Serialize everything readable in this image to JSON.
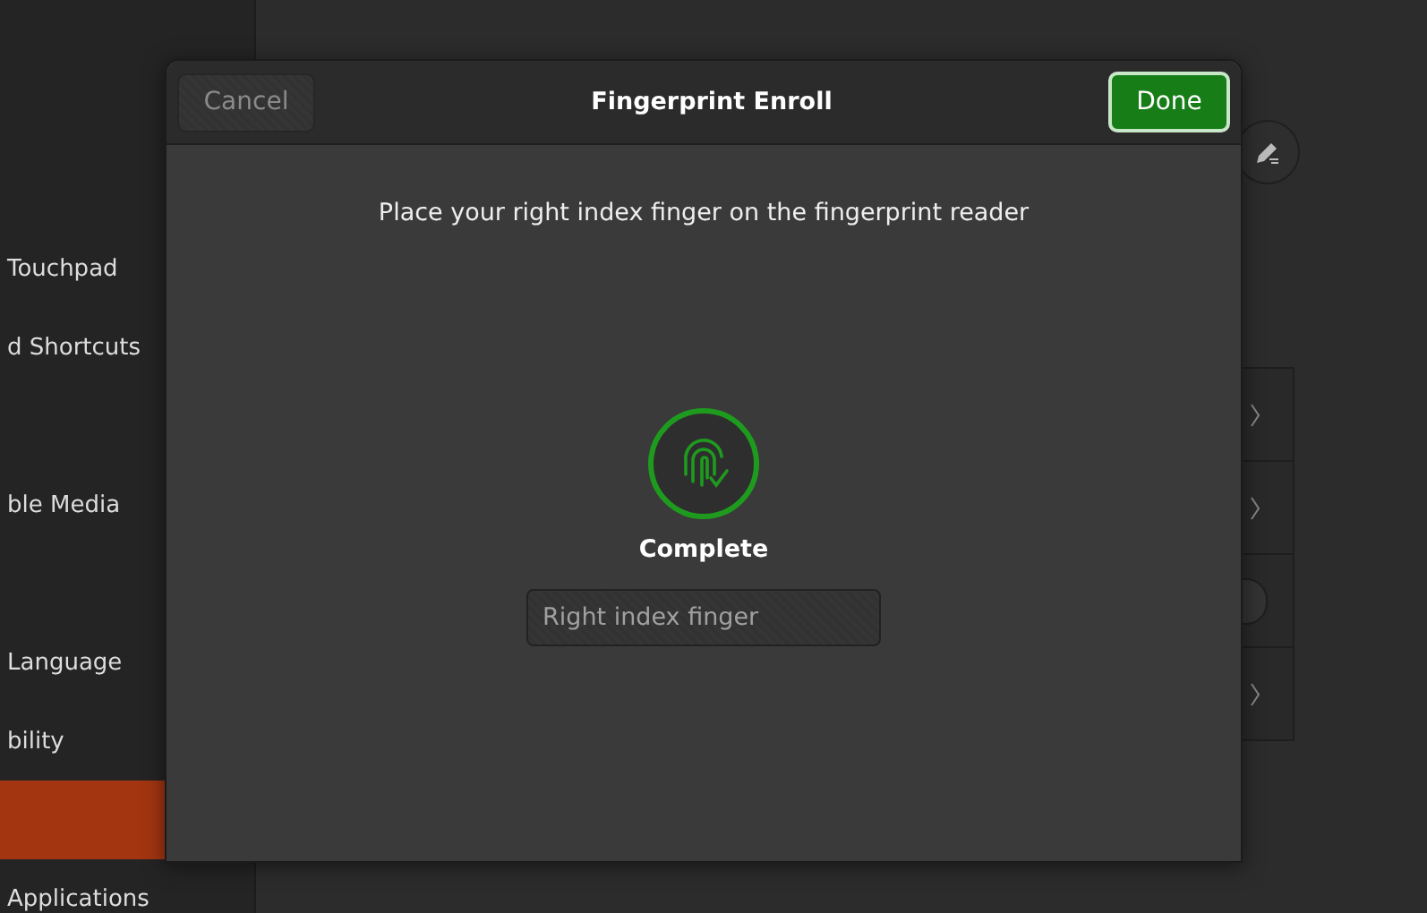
{
  "sidebar": {
    "items": [
      {
        "label": "Touchpad",
        "selected": false
      },
      {
        "label": "d Shortcuts",
        "selected": false
      },
      {
        "selected": false
      },
      {
        "label": "ble Media",
        "selected": false
      },
      {
        "selected": false
      },
      {
        "label": "Language",
        "selected": false
      },
      {
        "label": "bility",
        "selected": false
      },
      {
        "selected": true
      },
      {
        "label": "Applications",
        "selected": false
      }
    ]
  },
  "background_list": {
    "rows": [
      {
        "kind": "chevron"
      },
      {
        "kind": "chevron"
      },
      {
        "kind": "switch",
        "on": false
      },
      {
        "kind": "chevron"
      }
    ]
  },
  "dialog": {
    "title": "Fingerprint Enroll",
    "cancel_button": {
      "label": "Cancel",
      "disabled": true
    },
    "done_button": {
      "label": "Done"
    },
    "instruction": "Place your right index finger on the fingerprint reader",
    "status": "Complete",
    "finger_field": {
      "value": "Right index finger",
      "disabled": true
    }
  }
}
